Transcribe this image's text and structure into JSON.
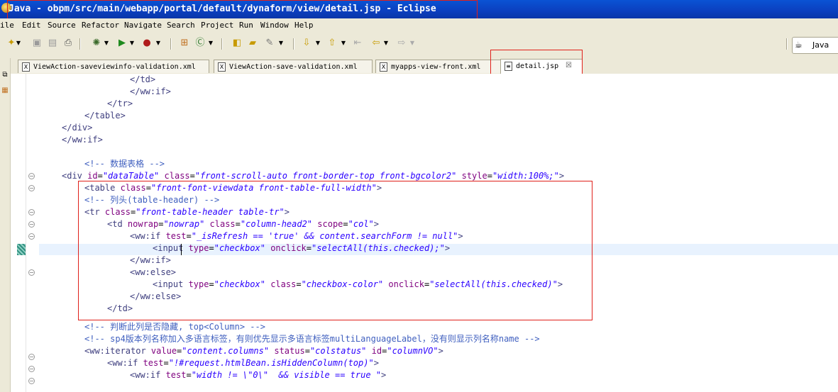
{
  "window": {
    "title": "Java - obpm/src/main/webapp/portal/default/dynaform/view/detail.jsp - Eclipse"
  },
  "menu": [
    "ile",
    "Edit",
    "Source",
    "Refactor",
    "Navigate",
    "Search",
    "Project",
    "Run",
    "Window",
    "Help"
  ],
  "toolbar": {
    "perspective_label": "Java"
  },
  "tabs": [
    {
      "label": "ViewAction-saveviewinfo-validation.xml",
      "icon": "xml-file-icon",
      "active": false
    },
    {
      "label": "ViewAction-save-validation.xml",
      "icon": "xml-file-icon",
      "active": false
    },
    {
      "label": "myapps-view-front.xml",
      "icon": "xml-file-icon",
      "active": false
    },
    {
      "label": "detail.jsp",
      "icon": "jsp-file-icon",
      "active": true
    }
  ],
  "code_lines": [
    [
      [
        "t",
        "</td>"
      ]
    ],
    [
      [
        "t",
        "</ww:if>"
      ]
    ],
    [
      [
        "t",
        "</tr>"
      ]
    ],
    [
      [
        "t",
        "</table>"
      ]
    ],
    [
      [
        "t",
        "</div>"
      ]
    ],
    [
      [
        "t",
        "</ww:if>"
      ]
    ],
    [],
    [
      [
        "c",
        "<!-- 数据表格 -->"
      ]
    ],
    [
      [
        "t",
        "<div "
      ],
      [
        "a",
        "id"
      ],
      [
        "k",
        "="
      ],
      [
        "v",
        "\"dataTable\""
      ],
      [
        "t",
        " "
      ],
      [
        "a",
        "class"
      ],
      [
        "k",
        "="
      ],
      [
        "v",
        "\"front-scroll-auto front-border-top front-bgcolor2\""
      ],
      [
        "t",
        " "
      ],
      [
        "a",
        "style"
      ],
      [
        "k",
        "="
      ],
      [
        "v",
        "\"width:100%;\""
      ],
      [
        "t",
        ">"
      ]
    ],
    [
      [
        "t",
        "<table "
      ],
      [
        "a",
        "class"
      ],
      [
        "k",
        "="
      ],
      [
        "v",
        "\"front-font-viewdata front-table-full-width\""
      ],
      [
        "t",
        ">"
      ]
    ],
    [
      [
        "c",
        "<!-- 列头(table-header) -->"
      ]
    ],
    [
      [
        "t",
        "<tr "
      ],
      [
        "a",
        "class"
      ],
      [
        "k",
        "="
      ],
      [
        "v",
        "\"front-table-header table-tr\""
      ],
      [
        "t",
        ">"
      ]
    ],
    [
      [
        "t",
        "<td "
      ],
      [
        "a",
        "nowrap"
      ],
      [
        "k",
        "="
      ],
      [
        "v",
        "\"nowrap\""
      ],
      [
        "t",
        " "
      ],
      [
        "a",
        "class"
      ],
      [
        "k",
        "="
      ],
      [
        "v",
        "\"column-head2\""
      ],
      [
        "t",
        " "
      ],
      [
        "a",
        "scope"
      ],
      [
        "k",
        "="
      ],
      [
        "v",
        "\"col\""
      ],
      [
        "t",
        ">"
      ]
    ],
    [
      [
        "t",
        "<ww:if "
      ],
      [
        "a",
        "test"
      ],
      [
        "k",
        "="
      ],
      [
        "v",
        "\"_isRefresh == 'true' && content.searchForm != null\""
      ],
      [
        "t",
        ">"
      ]
    ],
    [
      [
        "t",
        "<input "
      ],
      [
        "a",
        "type"
      ],
      [
        "k",
        "="
      ],
      [
        "v",
        "\"checkbox\""
      ],
      [
        "t",
        " "
      ],
      [
        "a",
        "onclick"
      ],
      [
        "k",
        "="
      ],
      [
        "v",
        "\"selectAll(this.checked);\""
      ],
      [
        "t",
        ">"
      ]
    ],
    [
      [
        "t",
        "</ww:if>"
      ]
    ],
    [
      [
        "t",
        "<ww:else>"
      ]
    ],
    [
      [
        "t",
        "<input "
      ],
      [
        "a",
        "type"
      ],
      [
        "k",
        "="
      ],
      [
        "v",
        "\"checkbox\""
      ],
      [
        "t",
        " "
      ],
      [
        "a",
        "class"
      ],
      [
        "k",
        "="
      ],
      [
        "v",
        "\"checkbox-color\""
      ],
      [
        "t",
        " "
      ],
      [
        "a",
        "onclick"
      ],
      [
        "k",
        "="
      ],
      [
        "v",
        "\"selectAll(this.checked)\""
      ],
      [
        "t",
        ">"
      ]
    ],
    [
      [
        "t",
        "</ww:else>"
      ]
    ],
    [
      [
        "t",
        "</td>"
      ]
    ],
    [],
    [
      [
        "c",
        "<!-- 判断此列是否隐藏, top<Column> -->"
      ]
    ],
    [
      [
        "c",
        "<!-- sp4版本列名称加入多语言标签，有则优先显示多语言标签multiLanguageLabel，没有则显示列名称name -->"
      ]
    ],
    [
      [
        "t",
        "<ww:iterator "
      ],
      [
        "a",
        "value"
      ],
      [
        "k",
        "="
      ],
      [
        "v",
        "\"content.columns\""
      ],
      [
        "t",
        " "
      ],
      [
        "a",
        "status"
      ],
      [
        "k",
        "="
      ],
      [
        "v",
        "\"colstatus\""
      ],
      [
        "t",
        " "
      ],
      [
        "a",
        "id"
      ],
      [
        "k",
        "="
      ],
      [
        "v",
        "\"columnVO\""
      ],
      [
        "t",
        ">"
      ]
    ],
    [
      [
        "t",
        "<ww:if "
      ],
      [
        "a",
        "test"
      ],
      [
        "k",
        "="
      ],
      [
        "v",
        "\"!#request.htmlBean.isHiddenColumn(top)\""
      ],
      [
        "t",
        ">"
      ]
    ],
    [
      [
        "t",
        "<ww:if "
      ],
      [
        "a",
        "test"
      ],
      [
        "k",
        "="
      ],
      [
        "v",
        "\"width != \\\"0\\\"  && visible == true \""
      ],
      [
        "t",
        ">"
      ]
    ]
  ]
}
